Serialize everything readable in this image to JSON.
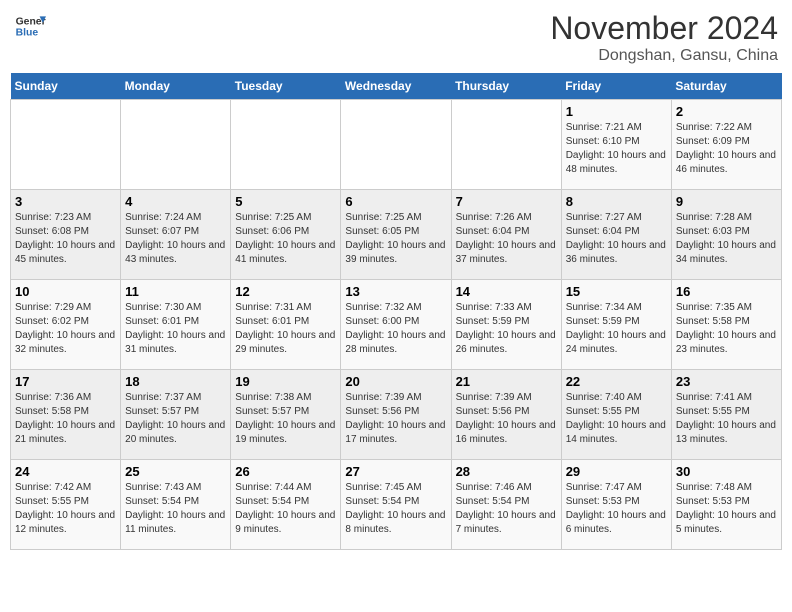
{
  "header": {
    "logo_line1": "General",
    "logo_line2": "Blue",
    "title": "November 2024",
    "subtitle": "Dongshan, Gansu, China"
  },
  "weekdays": [
    "Sunday",
    "Monday",
    "Tuesday",
    "Wednesday",
    "Thursday",
    "Friday",
    "Saturday"
  ],
  "weeks": [
    [
      {
        "day": "",
        "info": ""
      },
      {
        "day": "",
        "info": ""
      },
      {
        "day": "",
        "info": ""
      },
      {
        "day": "",
        "info": ""
      },
      {
        "day": "",
        "info": ""
      },
      {
        "day": "1",
        "info": "Sunrise: 7:21 AM\nSunset: 6:10 PM\nDaylight: 10 hours and 48 minutes."
      },
      {
        "day": "2",
        "info": "Sunrise: 7:22 AM\nSunset: 6:09 PM\nDaylight: 10 hours and 46 minutes."
      }
    ],
    [
      {
        "day": "3",
        "info": "Sunrise: 7:23 AM\nSunset: 6:08 PM\nDaylight: 10 hours and 45 minutes."
      },
      {
        "day": "4",
        "info": "Sunrise: 7:24 AM\nSunset: 6:07 PM\nDaylight: 10 hours and 43 minutes."
      },
      {
        "day": "5",
        "info": "Sunrise: 7:25 AM\nSunset: 6:06 PM\nDaylight: 10 hours and 41 minutes."
      },
      {
        "day": "6",
        "info": "Sunrise: 7:25 AM\nSunset: 6:05 PM\nDaylight: 10 hours and 39 minutes."
      },
      {
        "day": "7",
        "info": "Sunrise: 7:26 AM\nSunset: 6:04 PM\nDaylight: 10 hours and 37 minutes."
      },
      {
        "day": "8",
        "info": "Sunrise: 7:27 AM\nSunset: 6:04 PM\nDaylight: 10 hours and 36 minutes."
      },
      {
        "day": "9",
        "info": "Sunrise: 7:28 AM\nSunset: 6:03 PM\nDaylight: 10 hours and 34 minutes."
      }
    ],
    [
      {
        "day": "10",
        "info": "Sunrise: 7:29 AM\nSunset: 6:02 PM\nDaylight: 10 hours and 32 minutes."
      },
      {
        "day": "11",
        "info": "Sunrise: 7:30 AM\nSunset: 6:01 PM\nDaylight: 10 hours and 31 minutes."
      },
      {
        "day": "12",
        "info": "Sunrise: 7:31 AM\nSunset: 6:01 PM\nDaylight: 10 hours and 29 minutes."
      },
      {
        "day": "13",
        "info": "Sunrise: 7:32 AM\nSunset: 6:00 PM\nDaylight: 10 hours and 28 minutes."
      },
      {
        "day": "14",
        "info": "Sunrise: 7:33 AM\nSunset: 5:59 PM\nDaylight: 10 hours and 26 minutes."
      },
      {
        "day": "15",
        "info": "Sunrise: 7:34 AM\nSunset: 5:59 PM\nDaylight: 10 hours and 24 minutes."
      },
      {
        "day": "16",
        "info": "Sunrise: 7:35 AM\nSunset: 5:58 PM\nDaylight: 10 hours and 23 minutes."
      }
    ],
    [
      {
        "day": "17",
        "info": "Sunrise: 7:36 AM\nSunset: 5:58 PM\nDaylight: 10 hours and 21 minutes."
      },
      {
        "day": "18",
        "info": "Sunrise: 7:37 AM\nSunset: 5:57 PM\nDaylight: 10 hours and 20 minutes."
      },
      {
        "day": "19",
        "info": "Sunrise: 7:38 AM\nSunset: 5:57 PM\nDaylight: 10 hours and 19 minutes."
      },
      {
        "day": "20",
        "info": "Sunrise: 7:39 AM\nSunset: 5:56 PM\nDaylight: 10 hours and 17 minutes."
      },
      {
        "day": "21",
        "info": "Sunrise: 7:39 AM\nSunset: 5:56 PM\nDaylight: 10 hours and 16 minutes."
      },
      {
        "day": "22",
        "info": "Sunrise: 7:40 AM\nSunset: 5:55 PM\nDaylight: 10 hours and 14 minutes."
      },
      {
        "day": "23",
        "info": "Sunrise: 7:41 AM\nSunset: 5:55 PM\nDaylight: 10 hours and 13 minutes."
      }
    ],
    [
      {
        "day": "24",
        "info": "Sunrise: 7:42 AM\nSunset: 5:55 PM\nDaylight: 10 hours and 12 minutes."
      },
      {
        "day": "25",
        "info": "Sunrise: 7:43 AM\nSunset: 5:54 PM\nDaylight: 10 hours and 11 minutes."
      },
      {
        "day": "26",
        "info": "Sunrise: 7:44 AM\nSunset: 5:54 PM\nDaylight: 10 hours and 9 minutes."
      },
      {
        "day": "27",
        "info": "Sunrise: 7:45 AM\nSunset: 5:54 PM\nDaylight: 10 hours and 8 minutes."
      },
      {
        "day": "28",
        "info": "Sunrise: 7:46 AM\nSunset: 5:54 PM\nDaylight: 10 hours and 7 minutes."
      },
      {
        "day": "29",
        "info": "Sunrise: 7:47 AM\nSunset: 5:53 PM\nDaylight: 10 hours and 6 minutes."
      },
      {
        "day": "30",
        "info": "Sunrise: 7:48 AM\nSunset: 5:53 PM\nDaylight: 10 hours and 5 minutes."
      }
    ]
  ]
}
